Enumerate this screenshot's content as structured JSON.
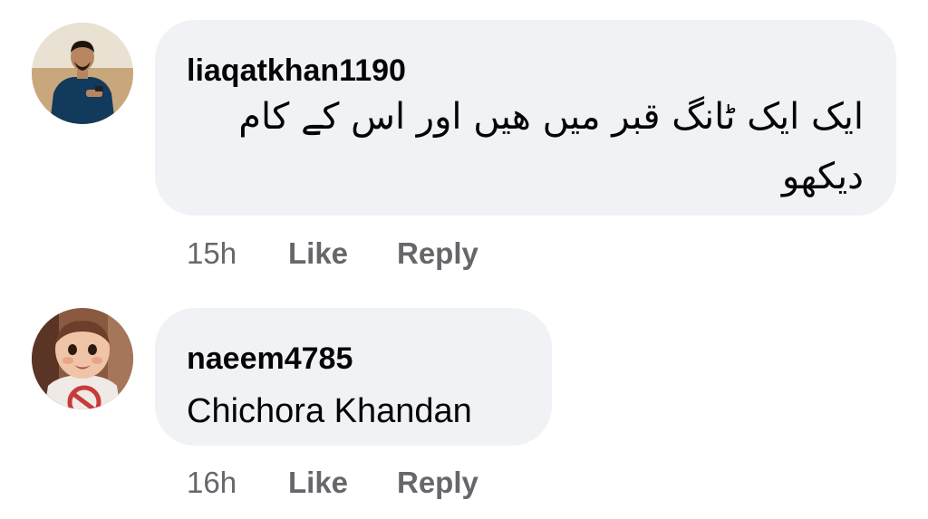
{
  "comments": [
    {
      "author": "liaqatkhan1190",
      "text": "ایک ایک ٹانگ قبر میں ھیں اور اس کے کام دیکھو",
      "time": "15h",
      "like_label": "Like",
      "reply_label": "Reply"
    },
    {
      "author": "naeem4785",
      "text": "Chichora Khandan",
      "time": "16h",
      "like_label": "Like",
      "reply_label": "Reply"
    }
  ],
  "colors": {
    "bubble": "#f0f2f5",
    "text": "#050505",
    "secondary": "#65676b"
  }
}
